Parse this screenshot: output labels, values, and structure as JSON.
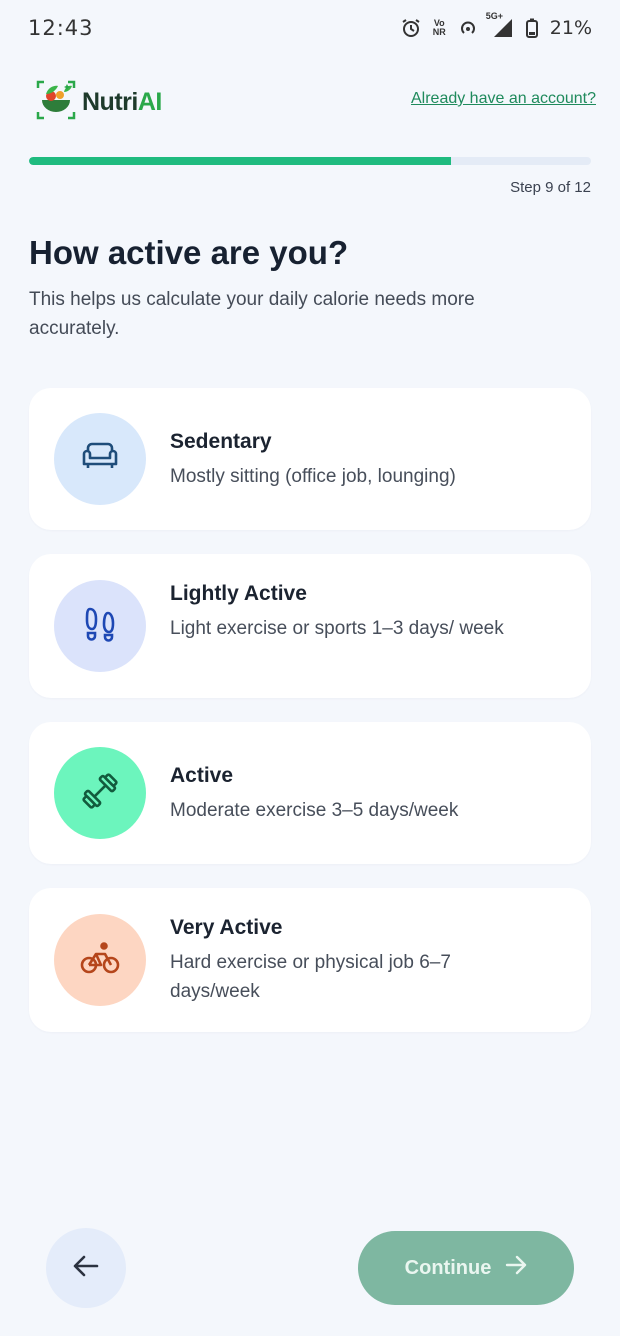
{
  "status_bar": {
    "time": "12:43",
    "network_label": "5G+",
    "volte_top": "Vo",
    "volte_bottom": "NR",
    "battery": "21%"
  },
  "header": {
    "logo_part1": "Nutri",
    "logo_part2": "AI",
    "signin_link": "Already have an account?"
  },
  "progress": {
    "step_label": "Step 9 of 12",
    "fraction": 0.75,
    "fill_color": "#1fbb7f"
  },
  "title": "How active are you?",
  "subtitle": "This helps us calculate your daily calorie needs more accurately.",
  "options": [
    {
      "title": "Sedentary",
      "desc": "Mostly sitting (office job, lounging)",
      "icon": "sofa-icon",
      "icon_bg": "#d8e8fb",
      "icon_color": "#1f4d7a"
    },
    {
      "title": "Lightly Active",
      "desc": "Light exercise or sports 1–3 days/ week",
      "icon": "footprints-icon",
      "icon_bg": "#dbe3fb",
      "icon_color": "#1e48b4"
    },
    {
      "title": "Active",
      "desc": "Moderate exercise 3–5 days/week",
      "icon": "dumbbell-icon",
      "icon_bg": "#6cf5bd",
      "icon_color": "#125b3d"
    },
    {
      "title": "Very Active",
      "desc": "Hard exercise or physical job 6–7 days/week",
      "icon": "bicycle-icon",
      "icon_bg": "#fdd6c2",
      "icon_color": "#b5461b"
    }
  ],
  "footer": {
    "continue_label": "Continue",
    "continue_color": "#7eb7a1"
  }
}
